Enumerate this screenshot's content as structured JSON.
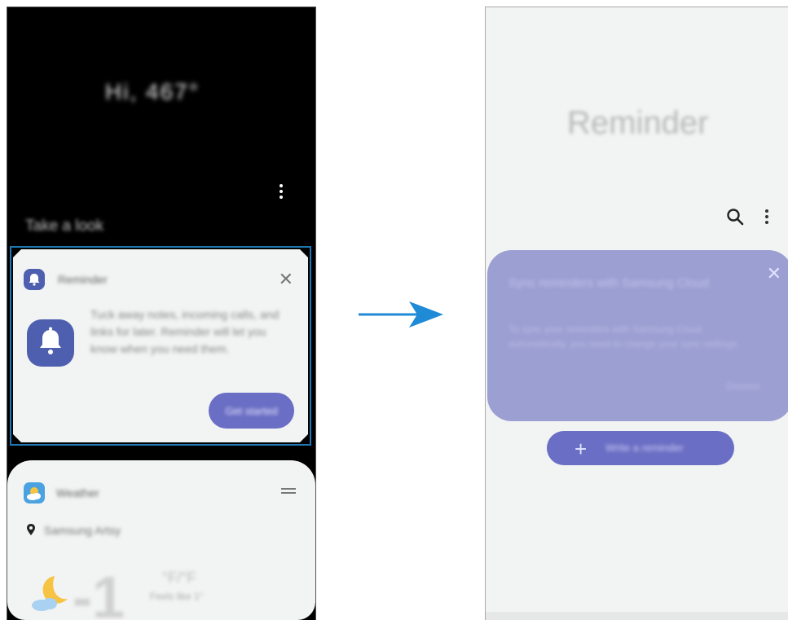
{
  "left_screen": {
    "greeting": "Hi, 467°",
    "take_a_look": "Take a look",
    "reminder_card": {
      "app_name": "Reminder",
      "description": "Tuck away notes, incoming calls, and links for later. Reminder will let you know when you need them.",
      "button_label": "Get started",
      "close_symbol": "✕"
    },
    "weather_card": {
      "app_name": "Weather",
      "location": "Samsung Artsy",
      "temperature": "-1",
      "degree_unit": "°F/°F",
      "feels_like": "Feels like 1°"
    }
  },
  "right_screen": {
    "title": "Reminder",
    "sync_card": {
      "title": "Sync reminders with Samsung Cloud",
      "body": "To sync your reminders with Samsung Cloud automatically, you need to change your sync settings.",
      "dismiss_label": "Dismiss",
      "close_symbol": "✕"
    },
    "write_button": {
      "plus": "+",
      "label": "Write a reminder"
    }
  },
  "colors": {
    "accent": "#6a6ec4",
    "reminder_icon": "#4f5fb0",
    "sync_card_bg": "#9c9fd2",
    "arrow": "#1f8ad6",
    "highlight_border": "#1f78b4"
  }
}
